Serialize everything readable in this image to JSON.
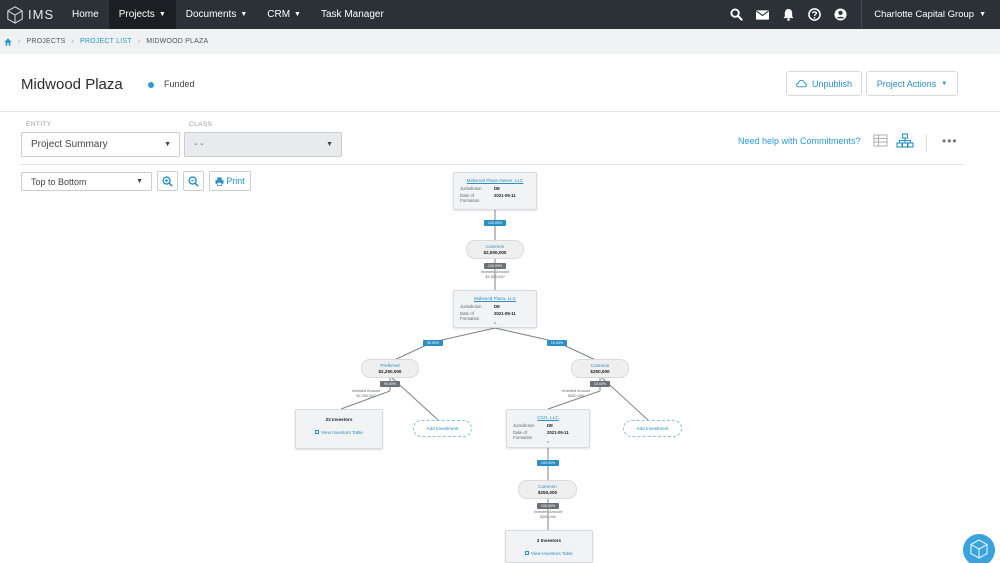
{
  "nav": {
    "logo_text": "IMS",
    "items": [
      {
        "label": "Home",
        "caret": false,
        "active": false
      },
      {
        "label": "Projects",
        "caret": true,
        "active": true
      },
      {
        "label": "Documents",
        "caret": true,
        "active": false
      },
      {
        "label": "CRM",
        "caret": true,
        "active": false
      },
      {
        "label": "Task Manager",
        "caret": false,
        "active": false
      }
    ],
    "org_name": "Charlotte Capital Group",
    "icons": [
      "search-icon",
      "mail-icon",
      "bell-icon",
      "help-icon",
      "user-icon"
    ]
  },
  "breadcrumb": {
    "items": [
      "PROJECTS",
      "PROJECT LIST",
      "MIDWOOD PLAZA"
    ]
  },
  "header": {
    "title": "Midwood Plaza",
    "status": "Funded",
    "unpublish_label": "Unpublish",
    "actions_label": "Project Actions"
  },
  "filters": {
    "entity_label": "ENTITY",
    "entity_value": "Project Summary",
    "class_label": "CLASS",
    "class_value": "- -",
    "help_text": "Need help with Commitments?"
  },
  "toolbar": {
    "direction_value": "Top to Bottom",
    "print_label": "Print"
  },
  "orgchart": {
    "entities": [
      {
        "id": "e1",
        "name": "Midwood Plaza Owner, LLC",
        "jurisdiction_label": "Jurisdiction",
        "jurisdiction": "DE",
        "formation_label": "Date of Formation",
        "formation": "2021-05-11"
      },
      {
        "id": "e2",
        "name": "Midwood Plaza, LLC",
        "jurisdiction_label": "Jurisdiction",
        "jurisdiction": "DE",
        "formation_label": "Date of Formation",
        "formation": "2021-05-11"
      },
      {
        "id": "e3",
        "name": "CCG, LLC",
        "jurisdiction_label": "Jurisdiction",
        "jurisdiction": "DE",
        "formation_label": "Date of Formation",
        "formation": "2021-05-11"
      }
    ],
    "classes": [
      {
        "id": "c1",
        "name": "Common",
        "amount": "$2,500,000",
        "pct_top": "100.00%",
        "pct_bottom": "100.00%",
        "invested_label": "Invested Amount",
        "invested": "$2,500,000"
      },
      {
        "id": "c2",
        "name": "Preferred",
        "amount": "$2,250,000",
        "pct_top": "90.00%",
        "pct_bottom": "90.00%",
        "invested_label": "Invested Amount",
        "invested": "$2,250,000"
      },
      {
        "id": "c3",
        "name": "Common",
        "amount": "$250,000",
        "pct_top": "10.00%",
        "pct_bottom": "10.00%",
        "invested_label": "Invested Amount",
        "invested": "$250,000"
      },
      {
        "id": "c4",
        "name": "Common",
        "amount": "$250,000",
        "pct_top": "100.00%",
        "pct_bottom": "100.00%",
        "invested_label": "Invested Amount",
        "invested": "$250,000"
      }
    ],
    "investor_boxes": [
      {
        "count": "23 Investors",
        "link": "View Investors Table"
      },
      {
        "count": "2 Investors",
        "link": "View Investors Table"
      }
    ],
    "add_investment_label": "Add Investment"
  },
  "colors": {
    "accent": "#2a9bd6",
    "nav_bg": "#2c3138"
  }
}
